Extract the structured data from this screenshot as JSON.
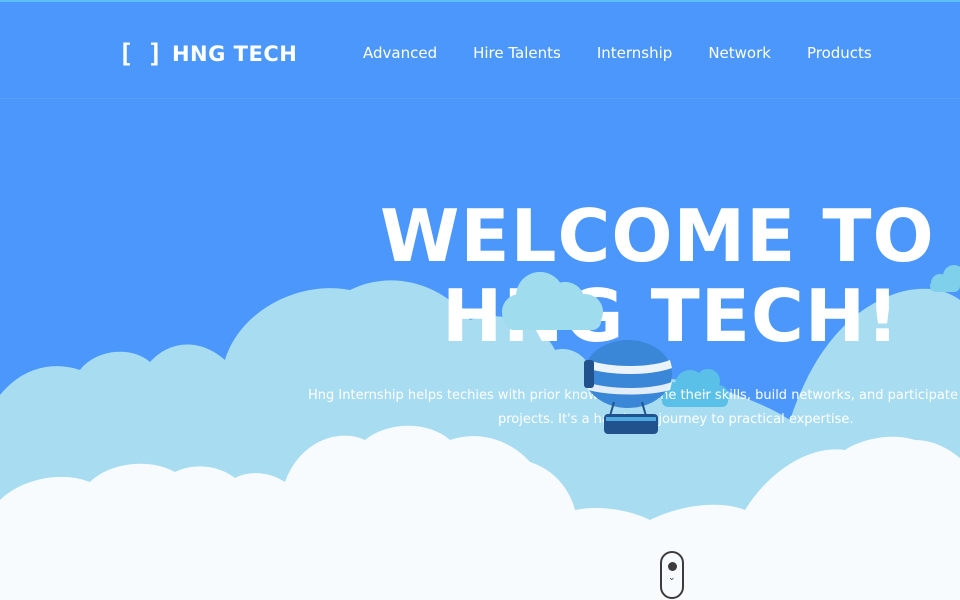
{
  "brand": {
    "mark": "[ ]",
    "name": "HNG TECH"
  },
  "nav": {
    "items": [
      {
        "label": "Advanced"
      },
      {
        "label": "Hire Talents"
      },
      {
        "label": "Internship"
      },
      {
        "label": "Network"
      },
      {
        "label": "Products"
      }
    ]
  },
  "hero": {
    "title_line1": "WELCOME TO",
    "title_line2": "HNG TECH!",
    "tagline_line1": "Hng Internship helps techies with prior knowledge refine their skills, build networks, and participate in",
    "tagline_line2": "projects. It's a hands-on journey to practical expertise."
  },
  "colors": {
    "sky": "#4c97fc",
    "cloud_back": "#a8dcf0",
    "cloud_front": "#f7fbfe",
    "small_cloud": "#9fdcee",
    "balloon_body": "#3a87d8",
    "balloon_dark": "#21528d"
  },
  "icons": {
    "scroll": "scroll-down-mouse-icon",
    "balloon": "airship-balloon-icon"
  }
}
